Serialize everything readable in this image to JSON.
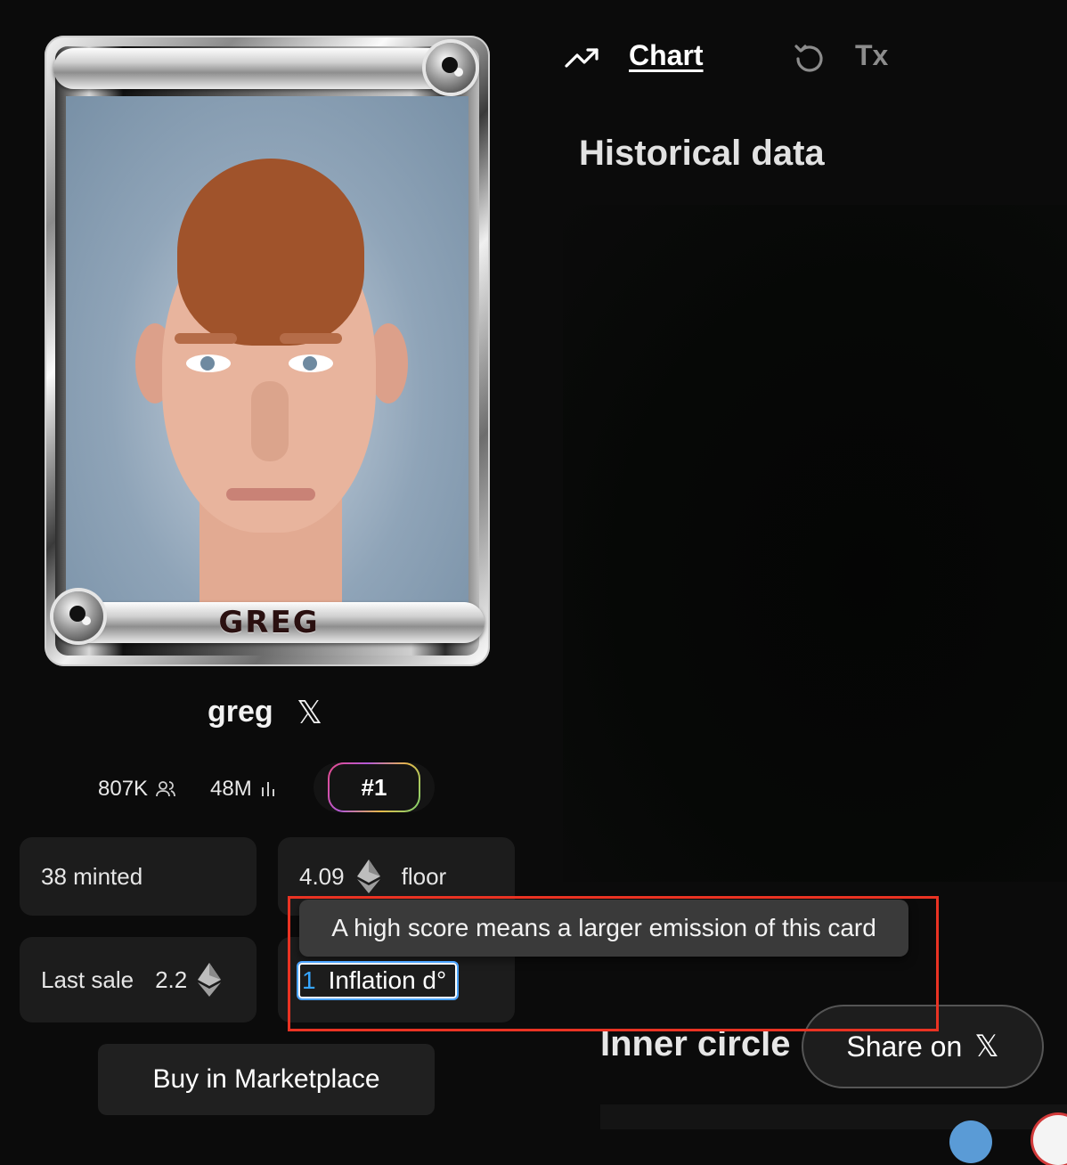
{
  "card": {
    "name": "GREG"
  },
  "profile": {
    "name": "greg",
    "x_icon": "x-logo-icon",
    "followers": "807K",
    "views": "48M",
    "rank": "#1"
  },
  "stats": {
    "minted": "38 minted",
    "floor_value": "4.09",
    "floor_label": "floor",
    "last_sale_label": "Last sale",
    "last_sale_value": "2.2"
  },
  "tooltip": {
    "text": "A high score means a larger emission of this card"
  },
  "inflation": {
    "value": "1",
    "label": "Inflation d°"
  },
  "buy_button": {
    "label": "Buy in Marketplace"
  },
  "tabs": {
    "chart": "Chart",
    "tx": "Tx"
  },
  "panel": {
    "title": "Historical data",
    "inner_circle": "Inner circle",
    "share_label": "Share on"
  },
  "colors": {
    "background": "#0b0b0b",
    "highlight": "#ea3323",
    "input_focus": "#4aa3ff"
  }
}
